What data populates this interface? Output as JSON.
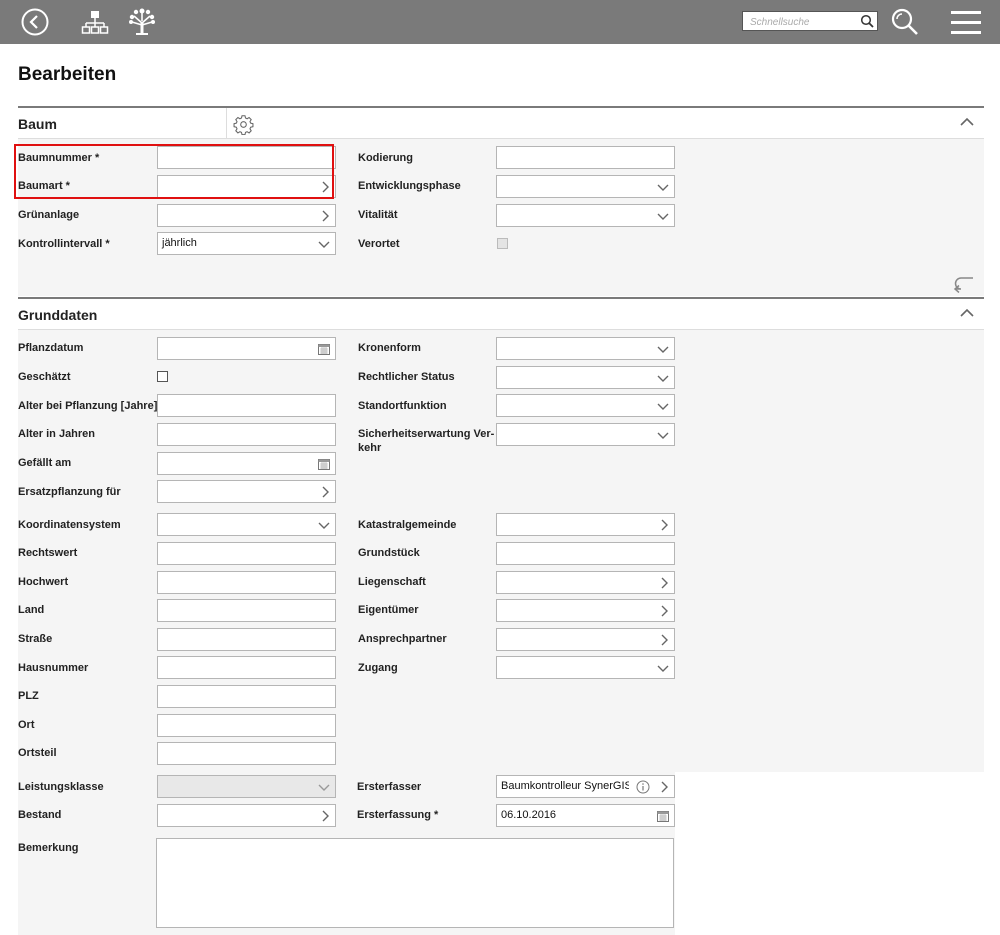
{
  "header": {
    "search_placeholder": "Schnellsuche",
    "icons": [
      "back-icon",
      "hierarchy-icon",
      "tree-icon",
      "search-icon",
      "magnifier-icon",
      "menu-icon"
    ]
  },
  "page_title": "Bearbeiten",
  "sections": {
    "baum": {
      "title": "Baum",
      "fields": {
        "baumnummer": {
          "label": "Baumnummer *",
          "value": ""
        },
        "baumart": {
          "label": "Baumart *",
          "value": ""
        },
        "gruenanlage": {
          "label": "Grünanlage",
          "value": ""
        },
        "kontrollintervall": {
          "label": "Kontrollintervall *",
          "value": "jährlich"
        },
        "kodierung": {
          "label": "Kodierung",
          "value": ""
        },
        "entwicklungsphase": {
          "label": "Entwicklungsphase",
          "value": ""
        },
        "vitalitaet": {
          "label": "Vitalität",
          "value": ""
        },
        "verortet": {
          "label": "Verortet",
          "checked": false
        }
      }
    },
    "grunddaten": {
      "title": "Grunddaten",
      "fields": {
        "pflanzdatum": {
          "label": "Pflanzdatum",
          "value": ""
        },
        "geschaetzt": {
          "label": "Geschätzt",
          "checked": false
        },
        "alter_pflanzung": {
          "label": "Alter bei Pflanzung [Jahre]",
          "value": ""
        },
        "alter_jahren": {
          "label": "Alter in Jahren",
          "value": ""
        },
        "gefaellt_am": {
          "label": "Gefällt am",
          "value": ""
        },
        "ersatzpflanzung": {
          "label": "Ersatzpflanzung für",
          "value": ""
        },
        "kronenform": {
          "label": "Kronenform",
          "value": ""
        },
        "rechtlicher_status": {
          "label": "Rechtlicher Status",
          "value": ""
        },
        "standortfunktion": {
          "label": "Standortfunktion",
          "value": ""
        },
        "sicherheitserwartung_1": {
          "label": "Sicherheitserwartung Ver-",
          "value": ""
        },
        "sicherheitserwartung_2": {
          "label": "kehr"
        },
        "koordinatensystem": {
          "label": "Koordinatensystem",
          "value": ""
        },
        "rechtswert": {
          "label": "Rechtswert",
          "value": ""
        },
        "hochwert": {
          "label": "Hochwert",
          "value": ""
        },
        "land": {
          "label": "Land",
          "value": ""
        },
        "strasse": {
          "label": "Straße",
          "value": ""
        },
        "hausnummer": {
          "label": "Hausnummer",
          "value": ""
        },
        "plz": {
          "label": "PLZ",
          "value": ""
        },
        "ort": {
          "label": "Ort",
          "value": ""
        },
        "ortsteil": {
          "label": "Ortsteil",
          "value": ""
        },
        "katastralgemeinde": {
          "label": "Katastralgemeinde",
          "value": ""
        },
        "grundstueck": {
          "label": "Grundstück",
          "value": ""
        },
        "liegenschaft": {
          "label": "Liegenschaft",
          "value": ""
        },
        "eigentuemer": {
          "label": "Eigentümer",
          "value": ""
        },
        "ansprechpartner": {
          "label": "Ansprechpartner",
          "value": ""
        },
        "zugang": {
          "label": "Zugang",
          "value": ""
        },
        "leistungsklasse": {
          "label": "Leistungsklasse",
          "value": ""
        },
        "bestand": {
          "label": "Bestand",
          "value": ""
        },
        "ersterfasser": {
          "label": "Ersterfasser",
          "value": "Baumkontrolleur SynerGIS"
        },
        "ersterfassung": {
          "label": "Ersterfassung *",
          "value": "06.10.2016"
        },
        "bemerkung": {
          "label": "Bemerkung",
          "value": ""
        }
      }
    }
  },
  "colors": {
    "topbar": "#7a7a7a",
    "highlight": "#e01010",
    "section_bg": "#f5f5f5"
  }
}
